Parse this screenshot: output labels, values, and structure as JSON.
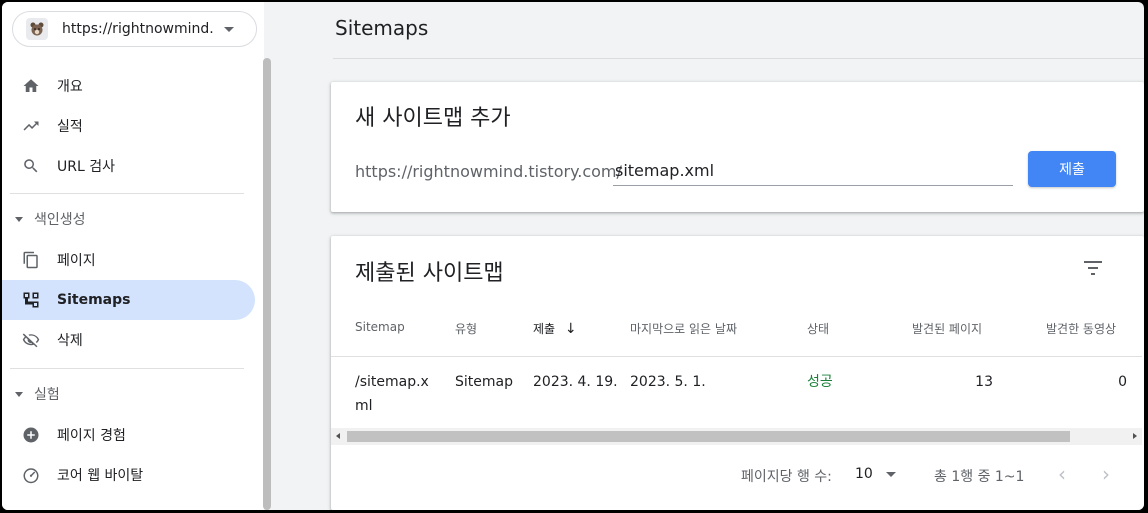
{
  "property": {
    "url": "https://rightnowmind...",
    "icon": "bear-favicon-icon"
  },
  "sidebar": {
    "items": [
      {
        "label": "개요",
        "icon": "home-icon"
      },
      {
        "label": "실적",
        "icon": "trending-up-icon"
      },
      {
        "label": "URL 검사",
        "icon": "search-icon"
      }
    ],
    "indexing_section": "색인생성",
    "indexing_items": [
      {
        "label": "페이지",
        "icon": "pages-icon"
      },
      {
        "label": "Sitemaps",
        "icon": "sitemap-icon",
        "active": true
      },
      {
        "label": "삭제",
        "icon": "visibility-off-icon"
      }
    ],
    "experience_section": "실험",
    "experience_items": [
      {
        "label": "페이지 경험",
        "icon": "add-circle-icon"
      },
      {
        "label": "코어 웹 바이탈",
        "icon": "speed-gauge-icon"
      }
    ]
  },
  "main": {
    "title": "Sitemaps",
    "add_card": {
      "title": "새 사이트맵 추가",
      "url_prefix": "https://rightnowmind.tistory.com/",
      "input_value": "sitemap.xml",
      "submit_label": "제출"
    },
    "submitted_card": {
      "title": "제출된 사이트맵",
      "columns": [
        "Sitemap",
        "유형",
        "제출",
        "마지막으로 읽은 날짜",
        "상태",
        "발견된 페이지",
        "발견한 동영상"
      ],
      "sorted_column": "제출",
      "rows": [
        {
          "sitemap_line1": "/sitemap.x",
          "sitemap_line2": "ml",
          "type": "Sitemap",
          "submitted": "2023. 4. 19.",
          "last_read": "2023. 5. 1.",
          "status": "성공",
          "pages": "13",
          "videos": "0"
        }
      ],
      "rows_per_page_label": "페이지당 행 수:",
      "rows_per_page": "10",
      "range_label": "총 1행 중 1~1"
    }
  },
  "colors": {
    "accent": "#4285f4",
    "active_nav": "#d3e3fd",
    "success": "#188038"
  }
}
